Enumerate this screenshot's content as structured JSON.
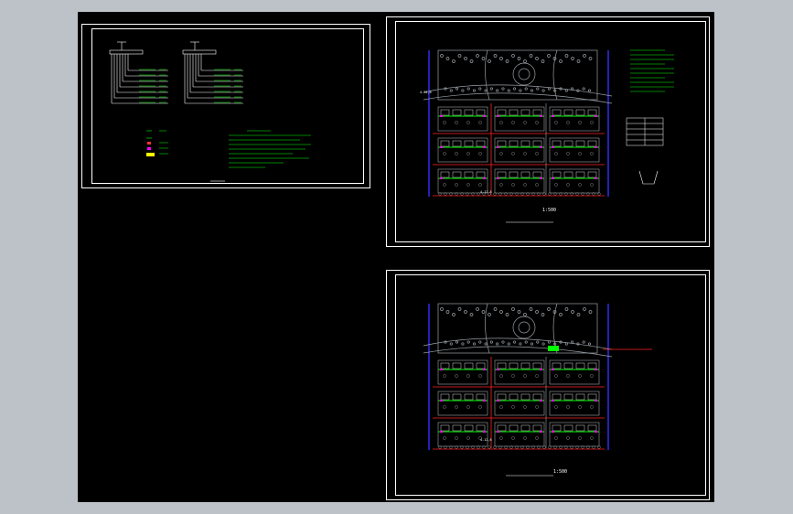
{
  "colors": {
    "app_background": "#bcc2c8",
    "drawing_background": "#000000",
    "frame": "#ffffff",
    "road": "#9aa0a6",
    "water_pipe": "#00ff00",
    "main_line": "#ff2222",
    "fixture": "#ff00ff",
    "boundary": "#3030ff"
  },
  "sheets": [
    {
      "id": "schematic",
      "description_icon": "system-diagram-icon"
    },
    {
      "id": "plan-top",
      "description_icon": "site-plan-icon"
    },
    {
      "id": "plan-bottom",
      "description_icon": "site-plan-icon"
    }
  ],
  "plan_top": {
    "dim_left": "4-12,8",
    "dim_bottom": "4-12,8",
    "scale": "1:500"
  },
  "plan_bottom": {
    "dim_bottom": "4-12,8",
    "scale": "1:500"
  }
}
